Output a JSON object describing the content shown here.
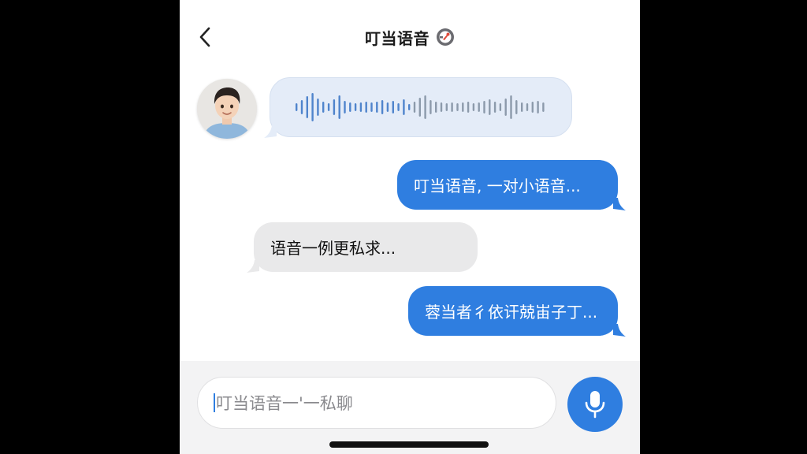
{
  "header": {
    "title": "叮当语音",
    "back_icon": "chevron-left-icon",
    "title_icon": "rocket-badge-icon"
  },
  "messages": [
    {
      "direction": "incoming",
      "type": "voice",
      "icon": "voice-waveform-icon"
    },
    {
      "direction": "outgoing",
      "type": "text",
      "text": "叮当语音, 一对小语音..."
    },
    {
      "direction": "incoming",
      "type": "text",
      "text": "语音一例更私求..."
    },
    {
      "direction": "outgoing",
      "type": "text",
      "text": "蓉当者彳依讦兢峀子丁..."
    }
  ],
  "composer": {
    "placeholder": "叮当语音一'一私聊",
    "mic_icon": "microphone-icon"
  },
  "colors": {
    "outgoing_bubble": "#2f7ee0",
    "incoming_bubble": "#e9e9ea",
    "voice_bubble": "#e4ecf8",
    "accent": "#2f7ee0"
  }
}
